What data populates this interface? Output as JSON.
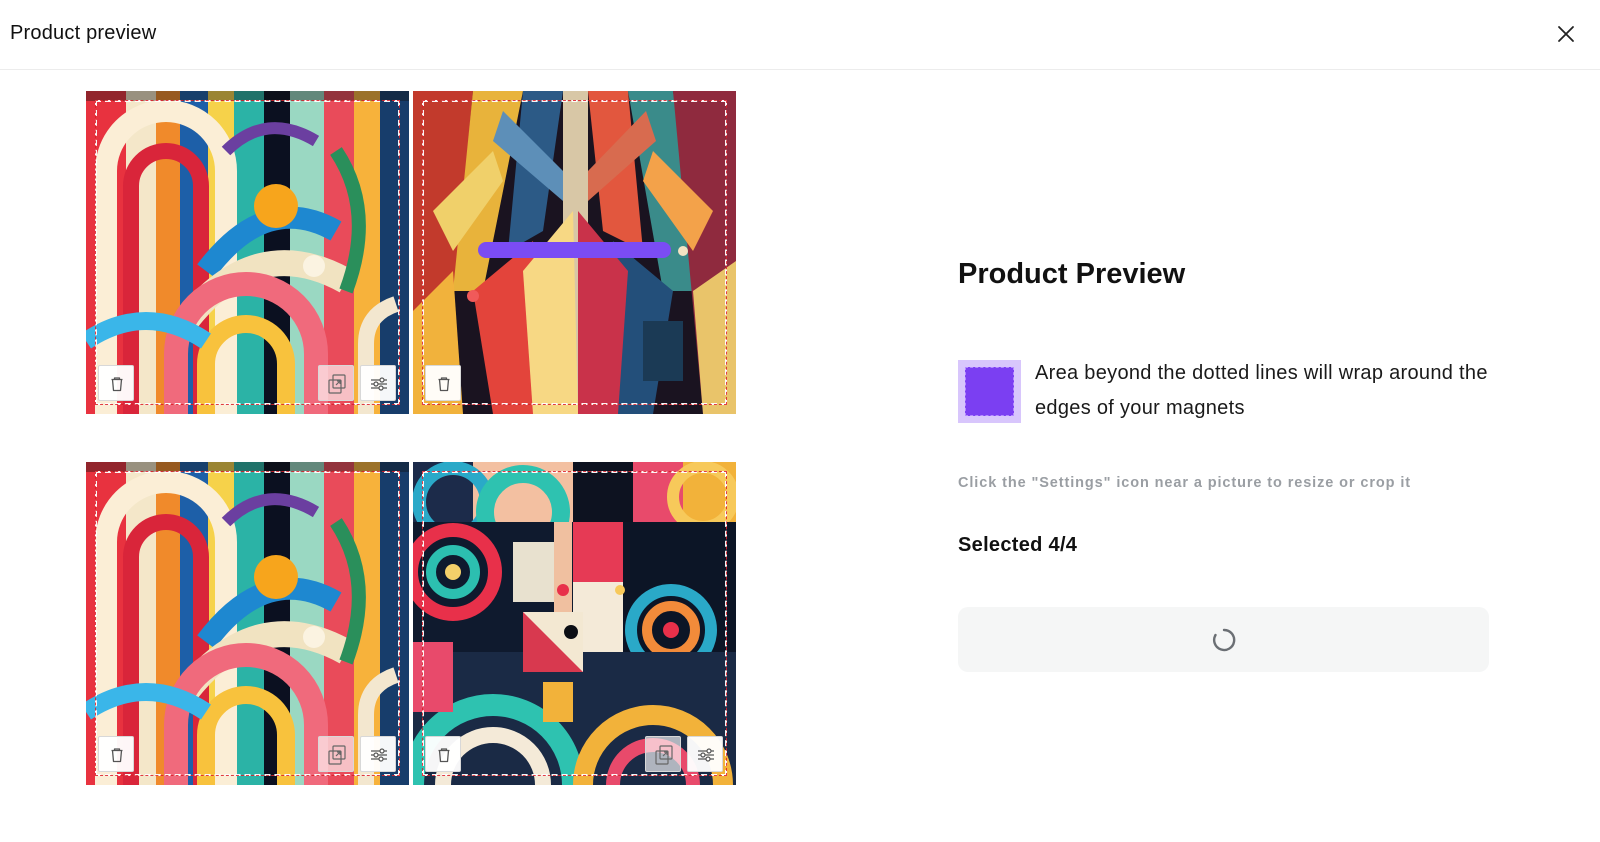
{
  "header": {
    "title": "Product preview",
    "close_icon": "close-icon"
  },
  "tiles": [
    {
      "art": "abstract-curves-a",
      "buttons": [
        "trash-icon",
        "replace-image-icon",
        "settings-sliders-icon"
      ]
    },
    {
      "art": "abstract-chevrons",
      "buttons": [
        "trash-icon"
      ],
      "loading_progress": 0.6
    },
    {
      "art": "abstract-curves-a",
      "buttons": [
        "trash-icon",
        "replace-image-icon",
        "settings-sliders-icon"
      ]
    },
    {
      "art": "abstract-circles-grid",
      "buttons": [
        "trash-icon",
        "replace-image-icon",
        "settings-sliders-icon"
      ]
    }
  ],
  "panel": {
    "title": "Product Preview",
    "wrap_note": "Area beyond the dotted lines will wrap around the edges of your magnets",
    "hint": "Click the \"Settings\" icon near a picture to resize or crop it",
    "selected": "Selected 4/4",
    "action_state": "loading"
  },
  "colors": {
    "accent": "#7b3ff2",
    "accent_light": "#d8c6fc",
    "hint_text": "#9a9ea3",
    "button_bg": "#f5f6f6"
  }
}
